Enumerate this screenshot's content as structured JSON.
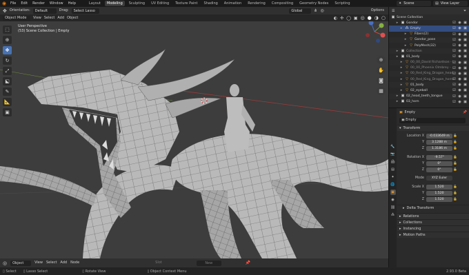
{
  "topbar": {
    "menus": [
      "File",
      "Edit",
      "Render",
      "Window",
      "Help"
    ],
    "workspaces": [
      "Layout",
      "Modeling",
      "Sculpting",
      "UV Editing",
      "Texture Paint",
      "Shading",
      "Animation",
      "Rendering",
      "Compositing",
      "Geometry Nodes",
      "Scripting"
    ],
    "active_workspace": "Modeling",
    "scene": "Scene",
    "view_layer": "View Layer"
  },
  "toolheader": {
    "orientation_label": "Orientation:",
    "orientation_value": "Default",
    "drag_label": "Drag:",
    "drag_value": "Select Lasso",
    "transform_orientation": "Global",
    "options": "Options"
  },
  "viewport_header": {
    "mode": "Object Mode",
    "menus": [
      "View",
      "Select",
      "Add",
      "Object"
    ]
  },
  "viewport": {
    "perspective": "User Perspective",
    "context": "(53) Scene Collection | Empty"
  },
  "outliner": {
    "title": "Scene Collection",
    "rows": [
      {
        "name": "Gondor",
        "indent": 1,
        "icon": "▣",
        "dim": false
      },
      {
        "name": "Empty",
        "indent": 2,
        "icon": "⁂",
        "dim": false,
        "selected": true
      },
      {
        "name": "Fibers(2)",
        "indent": 3,
        "icon": "▽",
        "dim": false
      },
      {
        "name": "Gondor_pose",
        "indent": 3,
        "icon": "▽",
        "dim": false
      },
      {
        "name": "PolyMesh(32)",
        "indent": 3,
        "icon": "▽",
        "dim": false
      },
      {
        "name": "Collection",
        "indent": 1,
        "icon": "▣",
        "dim": true
      },
      {
        "name": "01_body",
        "indent": 1,
        "icon": "▣",
        "dim": false
      },
      {
        "name": "00_00_David Richardson - I",
        "indent": 2,
        "icon": "▽",
        "dim": true
      },
      {
        "name": "00_00_Phoenix Olmbrey - .",
        "indent": 2,
        "icon": "▽",
        "dim": true
      },
      {
        "name": "00_Red_King_Dragon_head",
        "indent": 2,
        "icon": "▽",
        "dim": true
      },
      {
        "name": "00_Red_King_Dragon_horns",
        "indent": 2,
        "icon": "▽",
        "dim": true
      },
      {
        "name": "01_body",
        "indent": 2,
        "icon": "▽",
        "dim": false
      },
      {
        "name": "02_eyeball",
        "indent": 2,
        "icon": "▽",
        "dim": false
      },
      {
        "name": "02_head_teeth_tongue",
        "indent": 1,
        "icon": "▣",
        "dim": false
      },
      {
        "name": "03_horn",
        "indent": 1,
        "icon": "▣",
        "dim": false
      }
    ]
  },
  "properties": {
    "object_name": "Empty",
    "data_name": "Empty",
    "transform_panel": "Transform",
    "location_label": "Location X",
    "location": [
      "-0.033649 m",
      "3.1288 m",
      "1.3186 m"
    ],
    "rotation_label": "Rotation X",
    "rotation": [
      "-9.57°",
      "0°",
      "0°"
    ],
    "mode_label": "Mode",
    "mode_value": "XYZ Euler",
    "scale_label": "Scale X",
    "scale": [
      "1.520",
      "1.520",
      "1.520"
    ],
    "axis_labels": [
      "Y",
      "Z"
    ],
    "panels": [
      "Delta Transform",
      "Relations",
      "Collections",
      "Instancing",
      "Motion Paths"
    ]
  },
  "bottom_header": {
    "mode": "Object",
    "menus": [
      "View",
      "Select",
      "Add",
      "Node"
    ],
    "slot_label": "Slot",
    "new_label": "New"
  },
  "statusbar": {
    "items": [
      "Select",
      "Lasso Select",
      "Rotate View",
      "Object Context Menu"
    ],
    "version": "2.93.0 Beta"
  },
  "colors": {
    "accent": "#4772b3",
    "active_workspace_bg": "#3b3b3b",
    "mesh": "#b8b8b8",
    "wire": "#2a2a2a"
  }
}
